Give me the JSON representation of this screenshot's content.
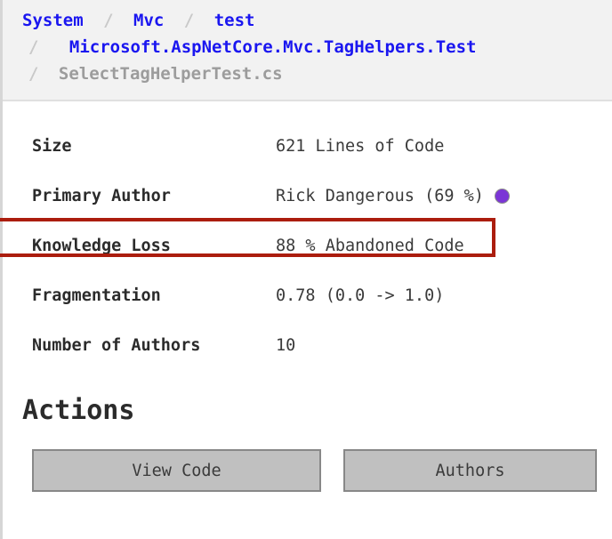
{
  "breadcrumb": {
    "separator": "/",
    "lines": [
      [
        {
          "text": "System",
          "type": "link"
        },
        {
          "text": "Mvc",
          "type": "link"
        },
        {
          "text": "test",
          "type": "link"
        }
      ],
      [
        {
          "text": "Microsoft.AspNetCore.Mvc.TagHelpers.Test",
          "type": "link"
        }
      ],
      [
        {
          "text": "SelectTagHelperTest.cs",
          "type": "current"
        }
      ]
    ],
    "items": {
      "system": "System",
      "mvc": "Mvc",
      "test": "test",
      "namespace": "Microsoft.AspNetCore.Mvc.TagHelpers.Test",
      "file": "SelectTagHelperTest.cs"
    }
  },
  "metrics": [
    {
      "label": "Size",
      "value": "621 Lines of Code",
      "highlighted": false,
      "dot": false
    },
    {
      "label": "Primary Author",
      "value": "Rick Dangerous (69 %)",
      "highlighted": false,
      "dot": true
    },
    {
      "label": "Knowledge Loss",
      "value": "88 % Abandoned Code",
      "highlighted": true,
      "dot": false
    },
    {
      "label": "Fragmentation",
      "value": "0.78 (0.0 -> 1.0)",
      "highlighted": false,
      "dot": false
    },
    {
      "label": "Number of Authors",
      "value": "10",
      "highlighted": false,
      "dot": false
    }
  ],
  "actions": {
    "title": "Actions",
    "view_code_label": "View Code",
    "authors_label": "Authors"
  },
  "colors": {
    "link": "#1a16f0",
    "current_crumb": "#9c9c9c",
    "highlight_border": "#ab1d0e",
    "author_dot": "#7b35d6",
    "button_bg": "#c0c0c0",
    "button_border": "#888888",
    "header_bg": "#f2f2f2"
  }
}
